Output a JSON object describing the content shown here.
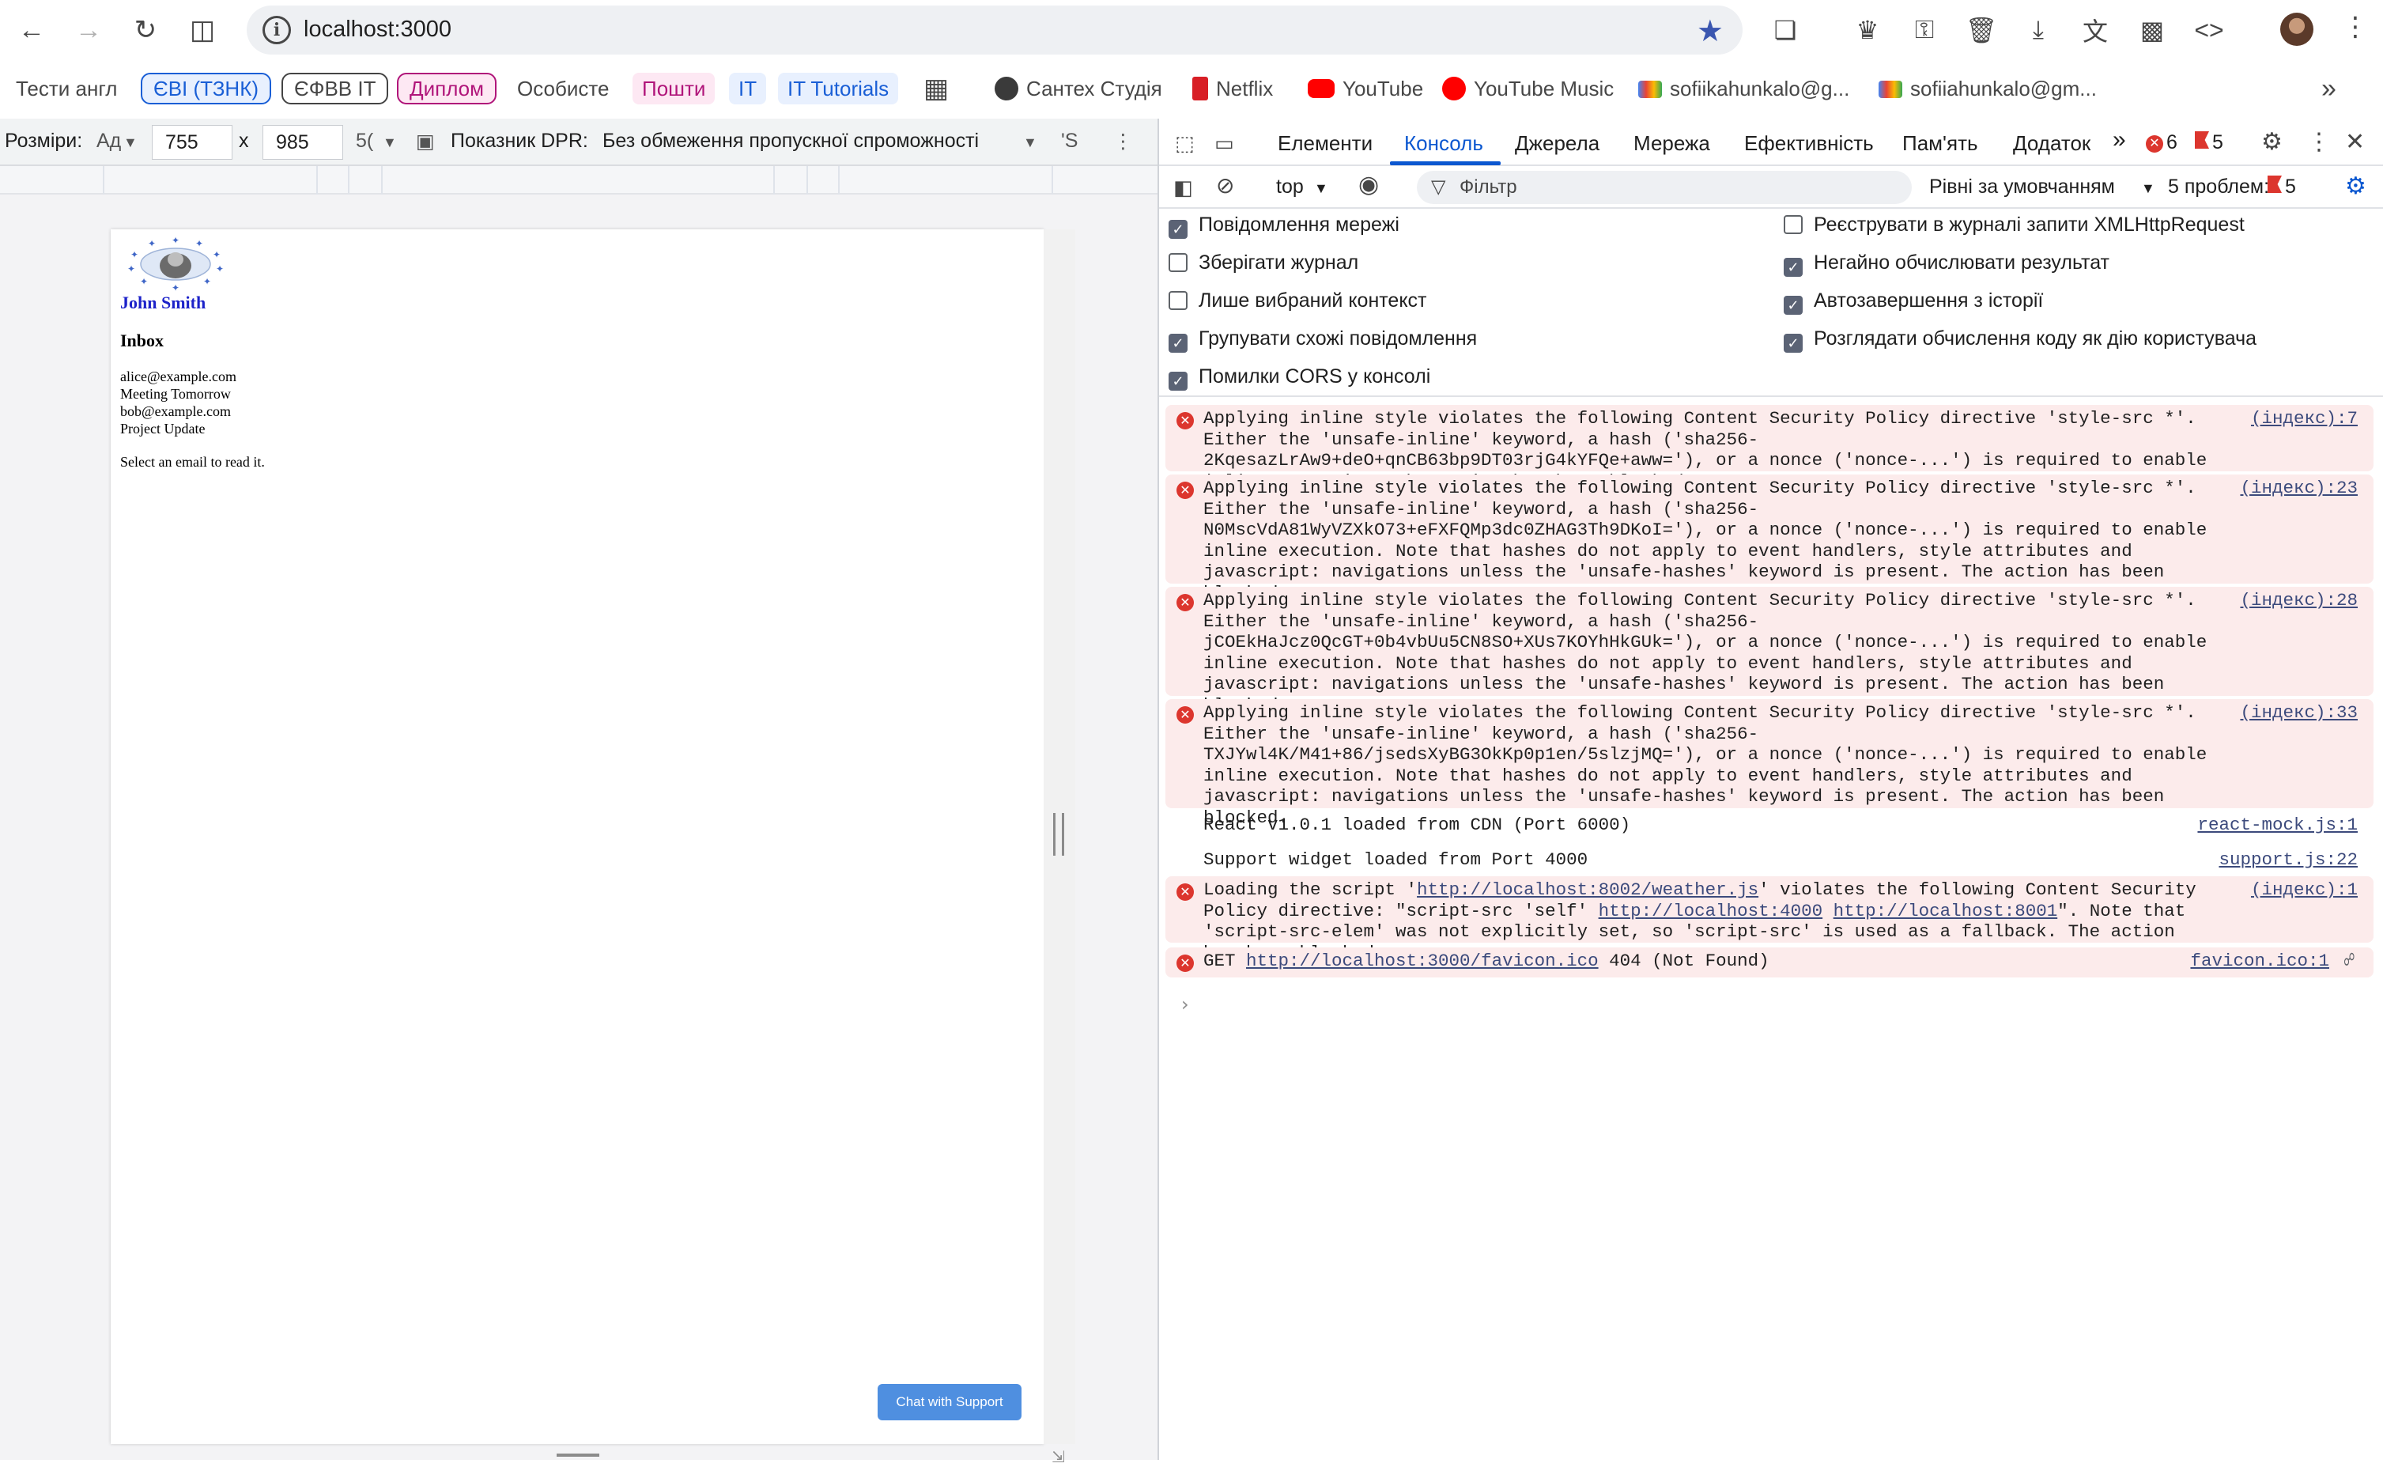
{
  "browser": {
    "url": "localhost:3000",
    "bookmarks": [
      "Тести англ",
      "ЄВІ (ТЗНК)",
      "ЄФВВ ІТ",
      "Диплом",
      "Особисте",
      "Пошти",
      "IT",
      "IT Tutorials",
      "Сантех Студія",
      "Netflix",
      "YouTube",
      "YouTube Music",
      "sofiikahunkalo@g...",
      "sofiiahunkalo@gm..."
    ],
    "more_bookmarks": "»"
  },
  "device_toolbar": {
    "dimensions_label": "Розміри:",
    "device_value": "Ад",
    "width": "755",
    "times": "x",
    "height": "985",
    "zoom": "5(",
    "dpr_label": "Показник DPR:",
    "throttling": "Без обмеження пропускної спроможності",
    "extra": "'S"
  },
  "page": {
    "profile_name": "John Smith",
    "inbox_title": "Inbox",
    "emails": [
      "alice@example.com",
      "Meeting Tomorrow",
      "bob@example.com",
      "Project Update"
    ],
    "hint": "Select an email to read it.",
    "chat_button": "Chat with Support"
  },
  "devtools": {
    "tabs": [
      "Елементи",
      "Консоль",
      "Джерела",
      "Мережа",
      "Ефективність",
      "Пам'ять",
      "Додаток"
    ],
    "more_tabs": "»",
    "error_count": "6",
    "issue_count": "5",
    "context": "top",
    "filter_placeholder": "Фільтр",
    "levels": "Рівні за умовчанням",
    "problems": "5 проблем:",
    "problems_count": "5",
    "options_left": [
      {
        "label": "Повідомлення мережі",
        "checked": true
      },
      {
        "label": "Зберігати журнал",
        "checked": false
      },
      {
        "label": "Лише вибраний контекст",
        "checked": false
      },
      {
        "label": "Групувати схожі повідомлення",
        "checked": true
      },
      {
        "label": "Помилки CORS у консолі",
        "checked": true
      }
    ],
    "options_right": [
      {
        "label": "Реєструвати в журналі запити XMLHttpRequest",
        "checked": false
      },
      {
        "label": "Негайно обчислювати результат",
        "checked": true
      },
      {
        "label": "Автозавершення з історії",
        "checked": true
      },
      {
        "label": "Розглядати обчислення коду як дію користувача",
        "checked": true
      }
    ],
    "messages": [
      {
        "type": "error",
        "text": "Applying inline style violates the following Content Security Policy directive 'style-src *'. Either the 'unsafe-inline' keyword, a hash ('sha256-2KqesazLrAw9+deO+qnCB63bp9DT03rjG4kYFQe+aww='), or a nonce ('nonce-...') is required to enable inline execution. The action has been blocked.",
        "source": "(індекс):7"
      },
      {
        "type": "error",
        "text": "Applying inline style violates the following Content Security Policy directive 'style-src *'. Either the 'unsafe-inline' keyword, a hash ('sha256-N0MscVdA81WyVZXkO73+eFXFQMp3dc0ZHAG3Th9DKoI='), or a nonce ('nonce-...') is required to enable inline execution. Note that hashes do not apply to event handlers, style attributes and javascript: navigations unless the 'unsafe-hashes' keyword is present. The action has been blocked.",
        "source": "(індекс):23"
      },
      {
        "type": "error",
        "text": "Applying inline style violates the following Content Security Policy directive 'style-src *'. Either the 'unsafe-inline' keyword, a hash ('sha256-jCOEkHaJcz0QcGT+0b4vbUu5CN8SO+XUs7KOYhHkGUk='), or a nonce ('nonce-...') is required to enable inline execution. Note that hashes do not apply to event handlers, style attributes and javascript: navigations unless the 'unsafe-hashes' keyword is present. The action has been blocked.",
        "source": "(індекс):28"
      },
      {
        "type": "error",
        "text": "Applying inline style violates the following Content Security Policy directive 'style-src *'. Either the 'unsafe-inline' keyword, a hash ('sha256-TXJYwl4K/M41+86/jsedsXyBG3OkKp0p1en/5slzjMQ='), or a nonce ('nonce-...') is required to enable inline execution. Note that hashes do not apply to event handlers, style attributes and javascript: navigations unless the 'unsafe-hashes' keyword is present. The action has been blocked.",
        "source": "(індекс):33"
      },
      {
        "type": "log",
        "text": "React v1.0.1 loaded from CDN (Port 6000)",
        "source": "react-mock.js:1"
      },
      {
        "type": "log",
        "text": "Support widget loaded from Port 4000",
        "source": "support.js:22"
      },
      {
        "type": "error",
        "text_before": "Loading the script '",
        "link1": "http://localhost:8002/weather.js",
        "text_mid": "' violates the following Content Security Policy directive: \"script-src 'self' ",
        "link2": "http://localhost:4000",
        "link3": "http://localhost:8001",
        "text_after": "\". Note that 'script-src-elem' was not explicitly set, so 'script-src' is used as a fallback. The action has been blocked.",
        "source": "(індекс):1"
      },
      {
        "type": "error",
        "text_before": "GET ",
        "link1": "http://localhost:3000/favicon.ico",
        "text_after": " 404 (Not Found)",
        "source": "favicon.ico:1"
      }
    ],
    "prompt": "›"
  }
}
